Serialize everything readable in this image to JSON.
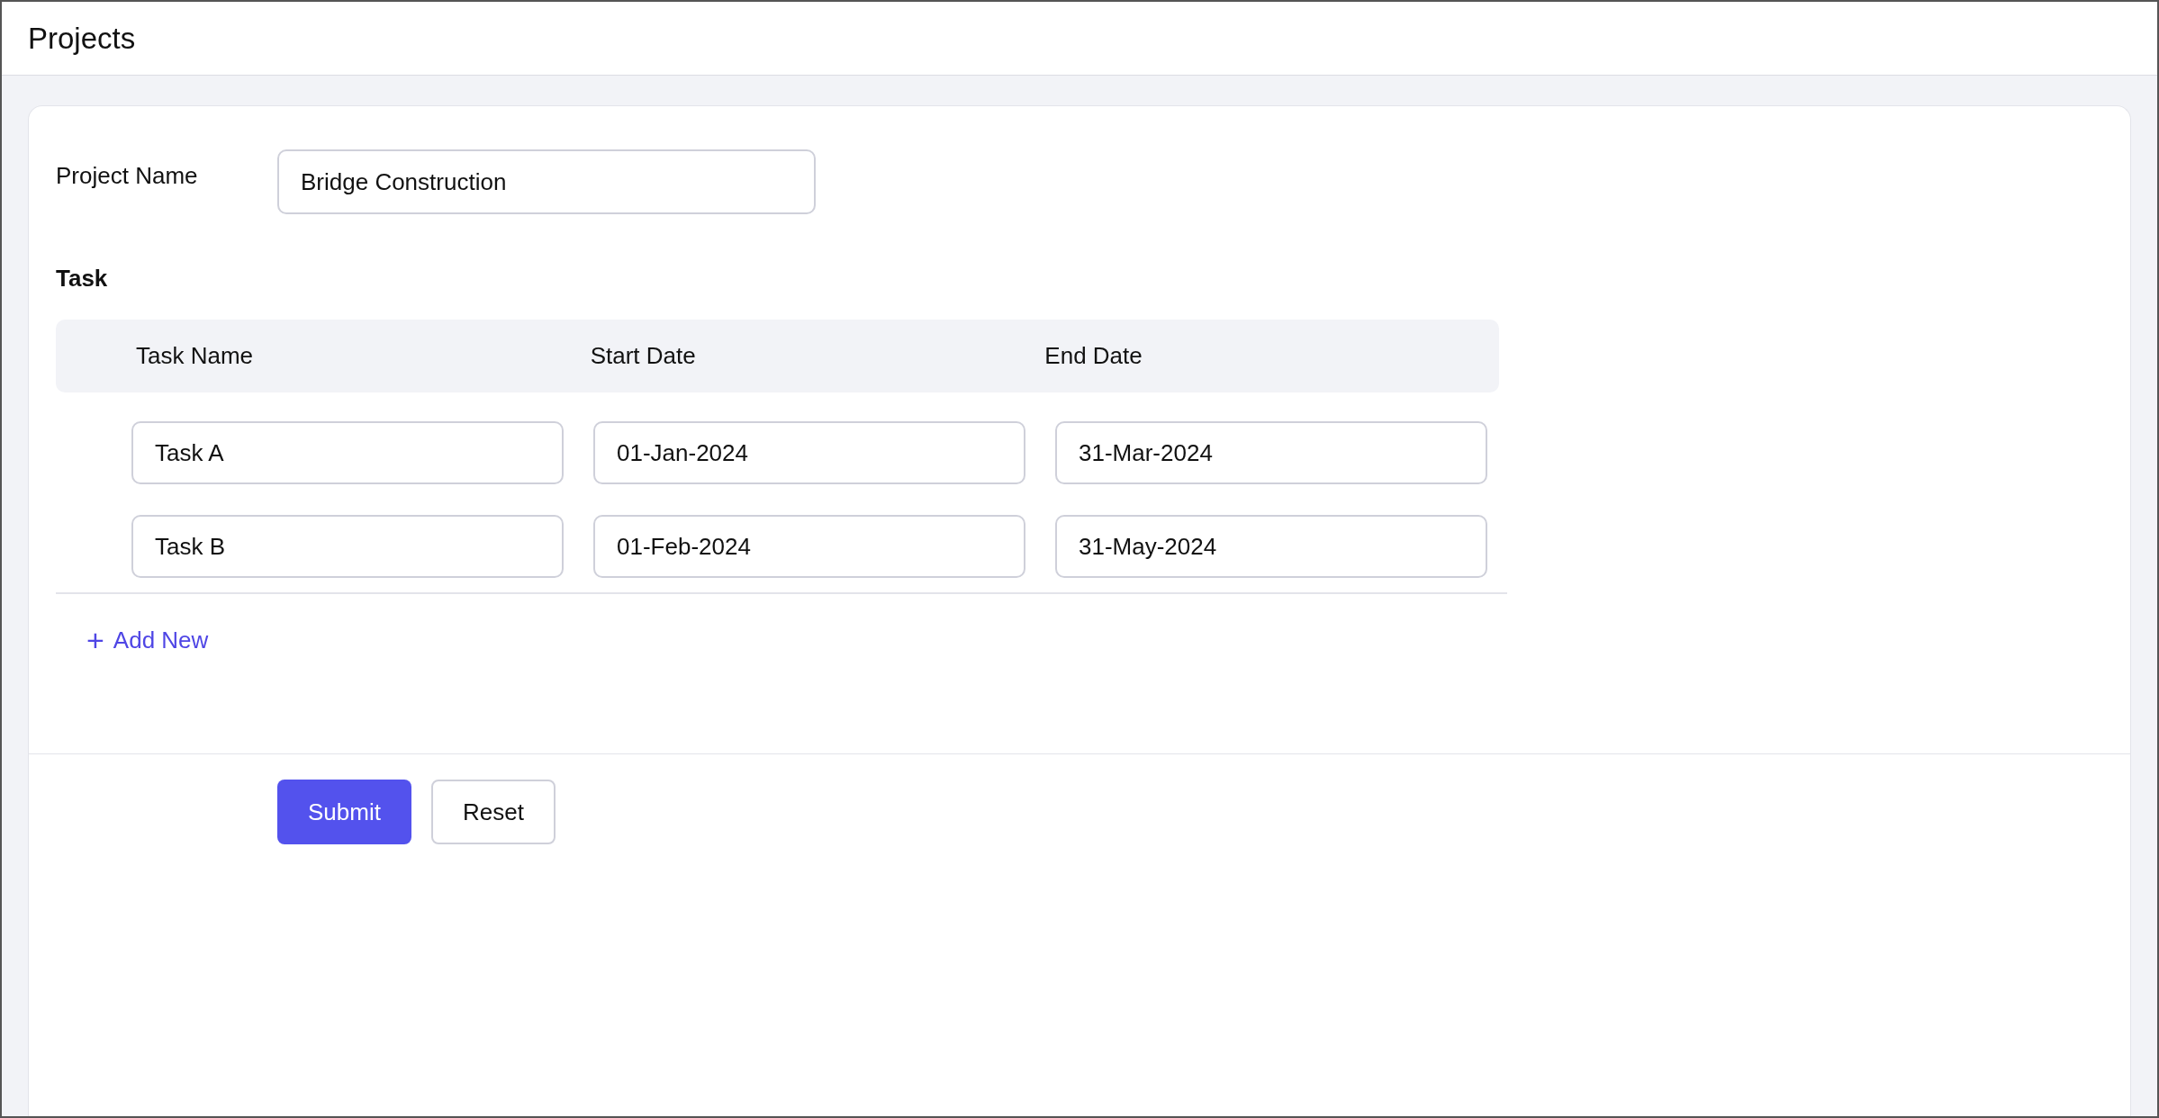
{
  "header": {
    "title": "Projects"
  },
  "form": {
    "project_name": {
      "label": "Project Name",
      "value": "Bridge Construction"
    },
    "task_section": {
      "label": "Task",
      "columns": [
        "Task Name",
        "Start Date",
        "End Date"
      ],
      "rows": [
        {
          "task_name": "Task A",
          "start_date": "01-Jan-2024",
          "end_date": "31-Mar-2024"
        },
        {
          "task_name": "Task B",
          "start_date": "01-Feb-2024",
          "end_date": "31-May-2024"
        }
      ],
      "add_link": {
        "icon": "+",
        "label": "Add New"
      }
    }
  },
  "buttons": [
    {
      "kind": "primary",
      "label": "Submit"
    },
    {
      "kind": "secondary",
      "label": "Reset"
    }
  ]
}
